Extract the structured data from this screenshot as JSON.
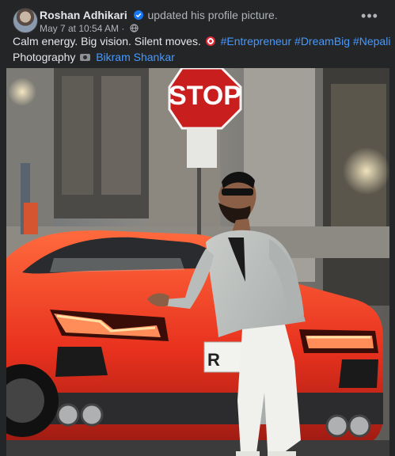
{
  "post": {
    "author": "Roshan Adhikari",
    "action": "updated his profile picture.",
    "timestamp": "May 7 at 10:54 AM",
    "separator": "·",
    "audience_icon": "globe-icon",
    "verified_icon": "verified-badge-icon",
    "more_icon": "more-options-icon",
    "more_label": "•••",
    "caption": {
      "text": "Calm energy. Big vision. Silent moves.",
      "emoji": "dart-emoji",
      "hashtags": [
        "#Entrepreneur",
        "#DreamBig",
        "#Nepali"
      ]
    },
    "credit": {
      "label": "Photography",
      "emoji": "camera-emoji",
      "photographer": "Bikram Shankar"
    },
    "photo": {
      "sign_text": "STOP",
      "plate_text": "R"
    }
  },
  "colors": {
    "background": "#242526",
    "text_primary": "#e4e6eb",
    "text_secondary": "#b0b3b8",
    "link": "#4599ff",
    "verified": "#1877f2",
    "car_red": "#e8311e",
    "stop_red": "#c81e1e"
  }
}
